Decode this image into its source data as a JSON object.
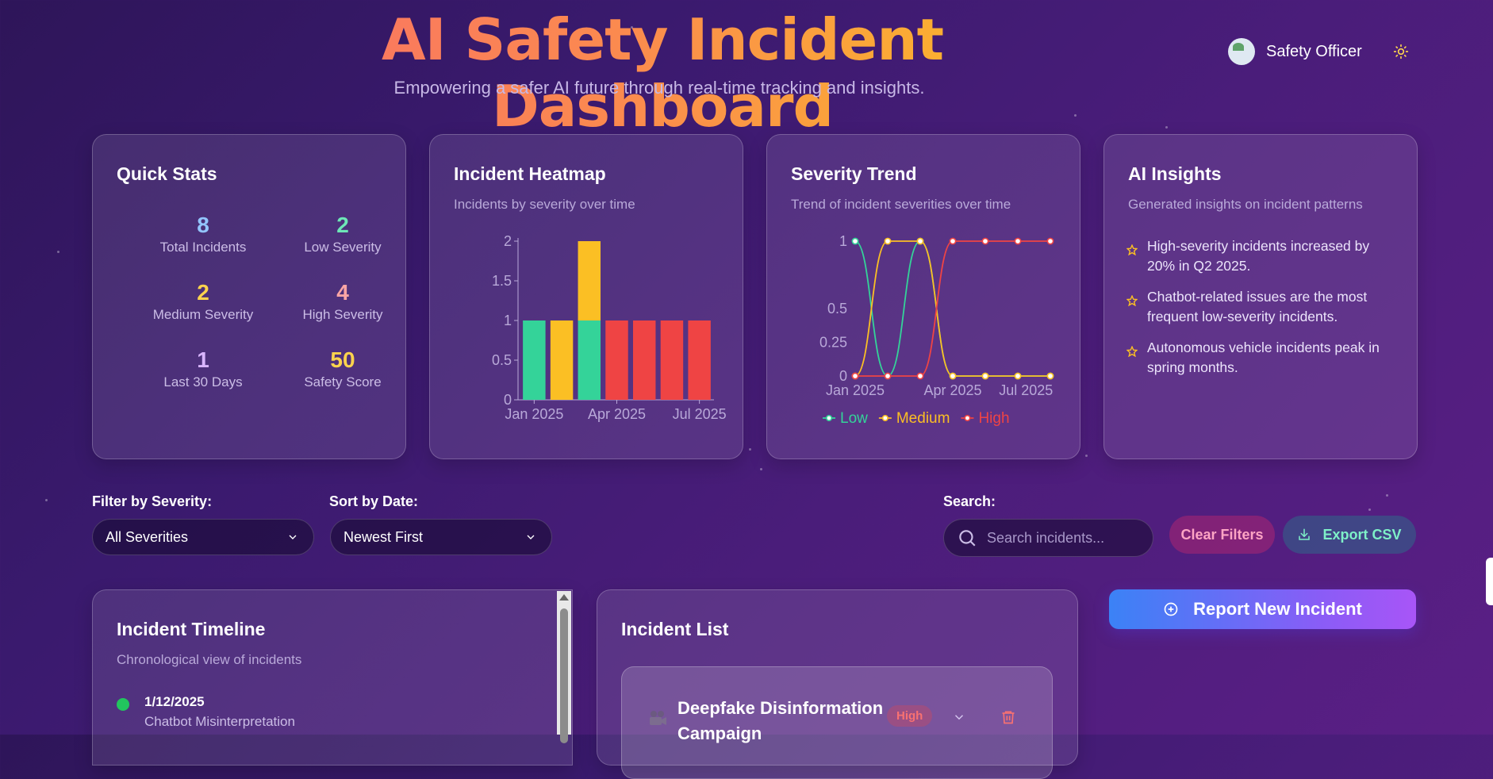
{
  "header": {
    "title": "AI Safety Incident Dashboard",
    "subtitle": "Empowering a safer AI future through real-time tracking and insights.",
    "user_name": "Safety Officer",
    "avatar_alt": "User",
    "theme_icon": "sun-icon"
  },
  "quick_stats": {
    "title": "Quick Stats",
    "items": [
      {
        "value": "8",
        "label": "Total Incidents",
        "color": "#93c5fd"
      },
      {
        "value": "2",
        "label": "Low Severity",
        "color": "#6ee7b7"
      },
      {
        "value": "2",
        "label": "Medium Severity",
        "color": "#fcd34d"
      },
      {
        "value": "4",
        "label": "High Severity",
        "color": "#fca5a5"
      },
      {
        "value": "1",
        "label": "Last 30 Days",
        "color": "#d8b4fe"
      },
      {
        "value": "50",
        "label": "Safety Score",
        "color": "#fcd34d"
      }
    ]
  },
  "heatmap": {
    "title": "Incident Heatmap",
    "subtitle": "Incidents by severity over time"
  },
  "trend": {
    "title": "Severity Trend",
    "subtitle": "Trend of incident severities over time"
  },
  "insights": {
    "title": "AI Insights",
    "subtitle": "Generated insights on incident patterns",
    "items": [
      "High-severity incidents increased by 20% in Q2 2025.",
      "Chatbot-related issues are the most frequent low-severity incidents.",
      "Autonomous vehicle incidents peak in spring months."
    ],
    "icon": "star-icon"
  },
  "chart_data": [
    {
      "type": "bar",
      "title": "Incident Heatmap",
      "categories": [
        "",
        "",
        "",
        "",
        "",
        "",
        ""
      ],
      "x_tick_labels": [
        "Jan 2025",
        "Apr 2025",
        "Jul 2025"
      ],
      "series": [
        {
          "values": [
            1,
            0,
            1,
            0,
            0,
            0,
            0
          ],
          "color": "#34d399"
        },
        {
          "values": [
            0,
            1,
            1,
            0,
            0,
            0,
            0
          ],
          "color": "#fbbf24"
        },
        {
          "values": [
            0,
            0,
            0,
            1,
            1,
            1,
            1
          ],
          "color": "#ef4444"
        }
      ],
      "stacked": true,
      "ylim": [
        0,
        2
      ],
      "y_ticks": [
        "0",
        "0.5",
        "1",
        "1.5",
        "2"
      ]
    },
    {
      "type": "line",
      "title": "Severity Trend",
      "x_points": 7,
      "x_tick_labels": [
        "Jan 2025",
        "Apr 2025",
        "Jul 2025"
      ],
      "series": [
        {
          "name": "Low",
          "values": [
            1,
            0,
            1,
            0,
            0,
            0,
            0
          ],
          "color": "#34d399"
        },
        {
          "name": "Medium",
          "values": [
            0,
            1,
            1,
            0,
            0,
            0,
            0
          ],
          "color": "#fbbf24"
        },
        {
          "name": "High",
          "values": [
            0,
            0,
            0,
            1,
            1,
            1,
            1
          ],
          "color": "#ef4444"
        }
      ],
      "ylim": [
        0,
        1
      ],
      "y_ticks": [
        "0",
        "0.25",
        "0.5",
        "1"
      ],
      "legend": "bottom"
    }
  ],
  "filters": {
    "severity_label": "Filter by Severity:",
    "severity_value": "All Severities",
    "sort_label": "Sort by Date:",
    "sort_value": "Newest First",
    "search_label": "Search:",
    "search_placeholder": "Search incidents...",
    "clear_label": "Clear Filters",
    "export_label": "Export CSV"
  },
  "report_button": "Report New Incident",
  "timeline": {
    "title": "Incident Timeline",
    "subtitle": "Chronological view of incidents",
    "items": [
      {
        "date": "1/12/2025",
        "title": "Chatbot Misinterpretation",
        "color": "#22c55e"
      }
    ]
  },
  "incident_list": {
    "title": "Incident List",
    "items": [
      {
        "title": "Deepfake Disinformation Campaign",
        "severity": "High",
        "icon": "video-camera-icon"
      }
    ]
  }
}
